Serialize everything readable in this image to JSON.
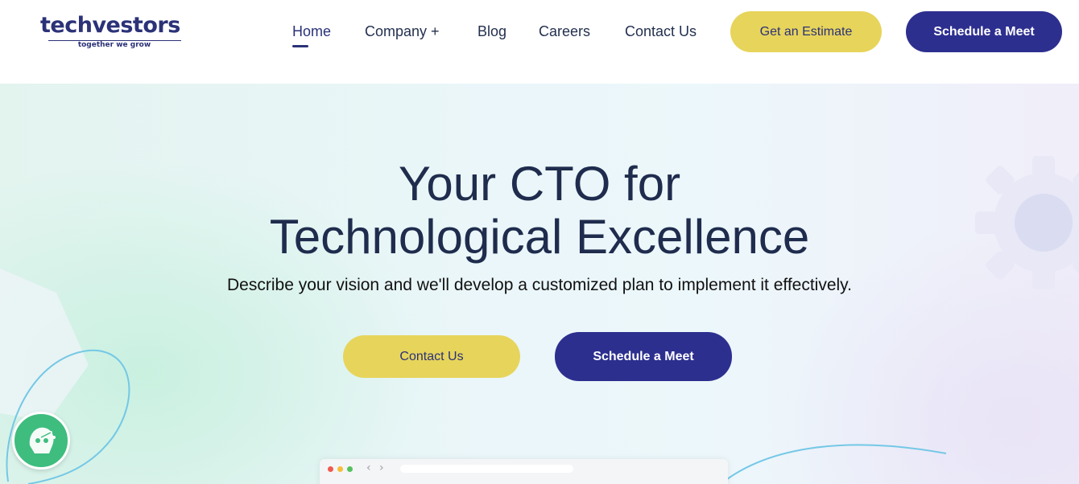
{
  "brand": {
    "name": "techvestors",
    "tagline": "together we grow",
    "primary_color": "#2d2f8f",
    "accent_color": "#e7d45b"
  },
  "nav": {
    "items": [
      {
        "label": "Home",
        "active": true
      },
      {
        "label": "Company +",
        "active": false
      },
      {
        "label": "Blog",
        "active": false
      },
      {
        "label": "Careers",
        "active": false
      },
      {
        "label": "Contact Us",
        "active": false
      }
    ]
  },
  "header_buttons": {
    "estimate": "Get an Estimate",
    "meet": "Schedule a Meet"
  },
  "hero": {
    "title_line1": "Your CTO for",
    "title_line2": "Technological Excellence",
    "subtitle": "Describe your vision and we'll develop a customized plan to implement it effectively.",
    "contact_button": "Contact Us",
    "meet_button": "Schedule a Meet"
  },
  "icons": {
    "chatbot": "chatbot-icon",
    "gear": "gear-icon"
  }
}
